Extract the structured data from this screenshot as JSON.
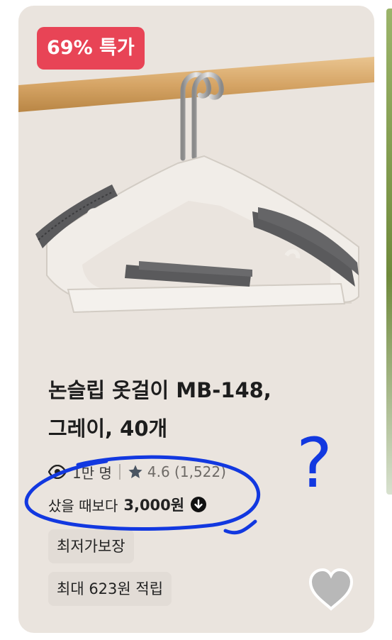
{
  "product": {
    "badge": "69% 특가",
    "title_line1": "논슬립 옷걸이 MB-148,",
    "title_line2": "그레이, 40개",
    "views": "1만 명",
    "rating": "4.6 (1,522)",
    "price_compare_label": "샀을 때보다",
    "price_compare_amount": "3,000원",
    "tag_lowest": "최저가보장",
    "tag_points": "최대 623원 적립"
  },
  "annotation": {
    "mark": "?"
  },
  "colors": {
    "card_bg": "#eae4de",
    "badge_bg": "#e84456",
    "tag_bg": "#e2dcd6",
    "annotation_blue": "#1238e0",
    "heart": "#b8b8b8"
  },
  "icons": [
    "eye-icon",
    "star-icon",
    "arrow-down-circle-icon",
    "heart-icon"
  ]
}
